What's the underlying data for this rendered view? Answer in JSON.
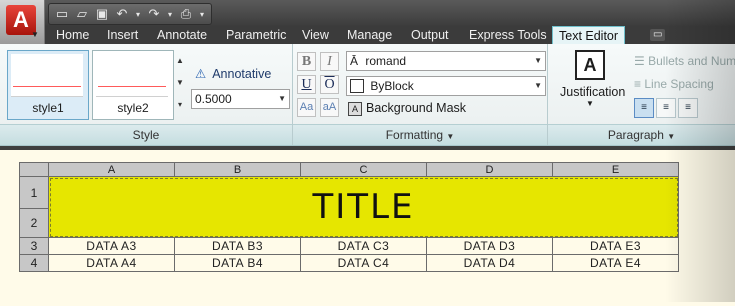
{
  "app": {
    "logo_letter": "A"
  },
  "quick_access": {
    "icons": [
      "new-icon",
      "open-icon",
      "save-icon",
      "undo-icon",
      "undo-dropdown-icon",
      "redo-icon",
      "redo-dropdown-icon",
      "plot-icon",
      "customize-icon"
    ]
  },
  "tabs": [
    "Home",
    "Insert",
    "Annotate",
    "Parametric",
    "View",
    "Manage",
    "Output",
    "Express Tools",
    "Text Editor"
  ],
  "active_tab": "Text Editor",
  "style_panel": {
    "title": "Style",
    "styles": [
      "style1",
      "style2"
    ],
    "annotative_label": "Annotative",
    "text_height": "0.5000"
  },
  "formatting_panel": {
    "title": "Formatting",
    "buttons": {
      "bold": "B",
      "italic": "I",
      "underline": "U",
      "overline": "O",
      "uppercase": "Aa",
      "lowercase": "aA"
    },
    "font": "romand",
    "color": "ByBlock",
    "background_mask": "Background Mask"
  },
  "paragraph_panel": {
    "title": "Paragraph",
    "justification": "Justification",
    "bullets": "Bullets and Numbering",
    "line_spacing": "Line Spacing"
  },
  "table": {
    "columns": [
      "A",
      "B",
      "C",
      "D",
      "E"
    ],
    "row_numbers": [
      "1",
      "2",
      "3",
      "4"
    ],
    "title": "TITLE",
    "rows": [
      [
        "DATA A3",
        "DATA B3",
        "DATA C3",
        "DATA D3",
        "DATA E3"
      ],
      [
        "DATA A4",
        "DATA B4",
        "DATA C4",
        "DATA D4",
        "DATA E4"
      ]
    ]
  },
  "colors": {
    "ribbon_accent": "#6fc0cc",
    "title_cell": "#e6e600",
    "drawing_bg": "#fffbe9"
  }
}
